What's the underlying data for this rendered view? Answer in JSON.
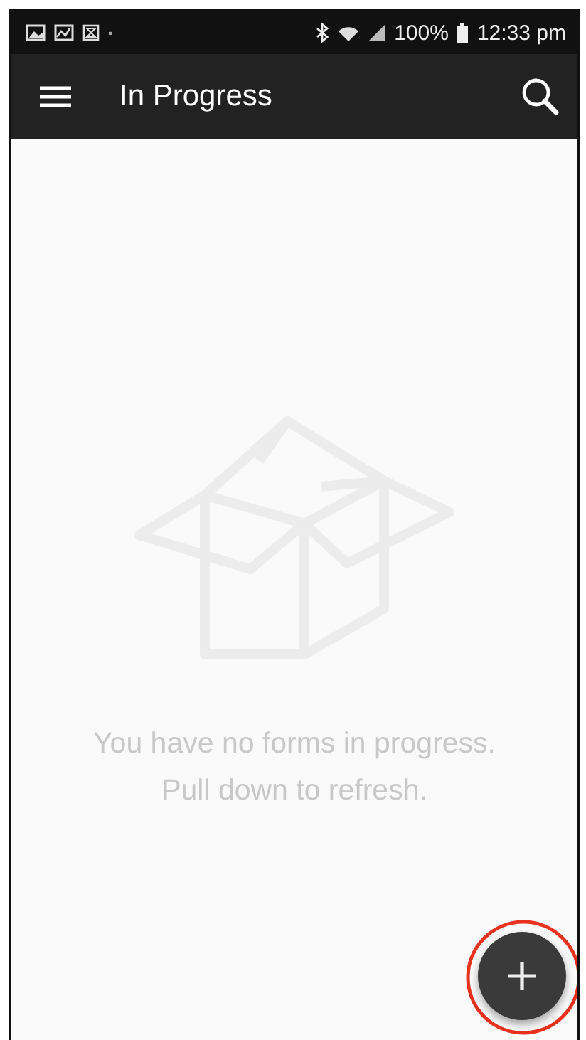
{
  "status_bar": {
    "battery": "100%",
    "time": "12:33 pm"
  },
  "app_bar": {
    "title": "In Progress"
  },
  "empty_state": {
    "lines": [
      "You have no forms in progress.",
      "Pull down to refresh."
    ]
  }
}
